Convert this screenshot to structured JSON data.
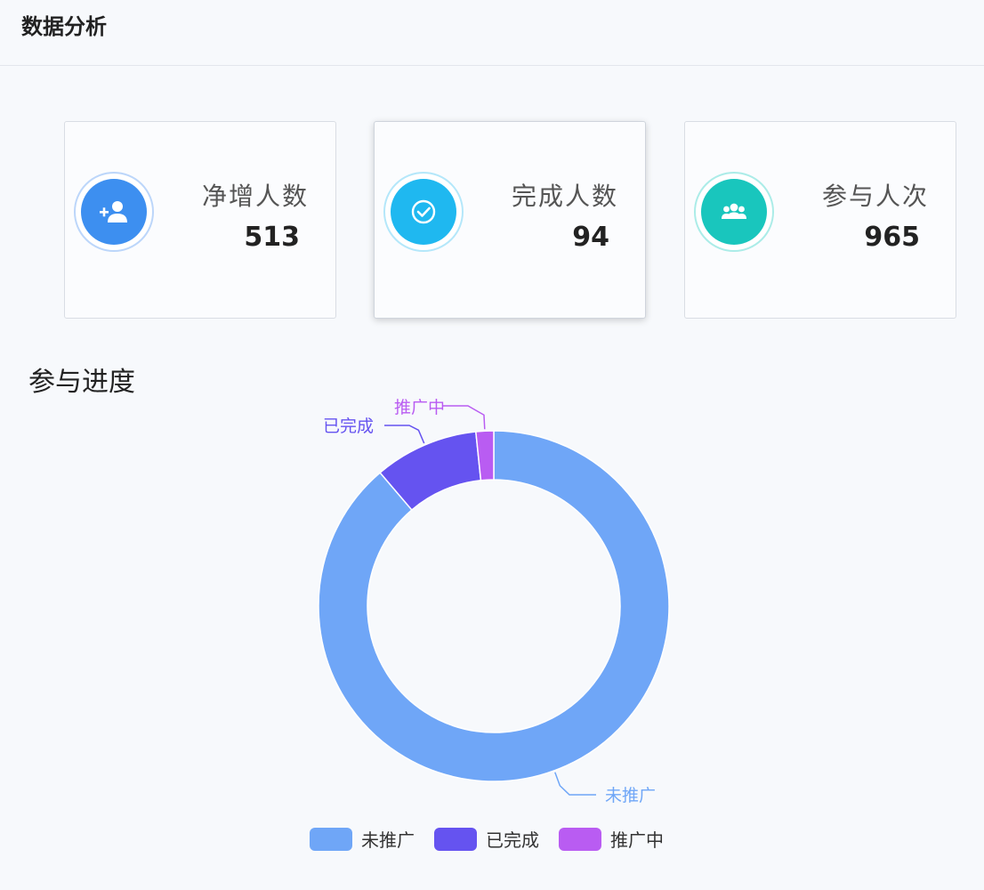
{
  "header": {
    "title": "数据分析"
  },
  "stats": [
    {
      "label": "净增人数",
      "value": "513",
      "icon": "add-user-icon",
      "color": "#3d8ff0"
    },
    {
      "label": "完成人数",
      "value": "94",
      "icon": "check-circle-icon",
      "color": "#1fb8f0"
    },
    {
      "label": "参与人次",
      "value": "965",
      "icon": "group-icon",
      "color": "#19c6bd"
    }
  ],
  "section": {
    "title": "参与进度"
  },
  "chart_data": {
    "type": "pie",
    "categories": [
      "未推广",
      "已完成",
      "推广中"
    ],
    "values": [
      869,
      94,
      16
    ],
    "colors": [
      "#6fa6f7",
      "#6553f0",
      "#b95cf2"
    ],
    "legend": "bottom"
  }
}
